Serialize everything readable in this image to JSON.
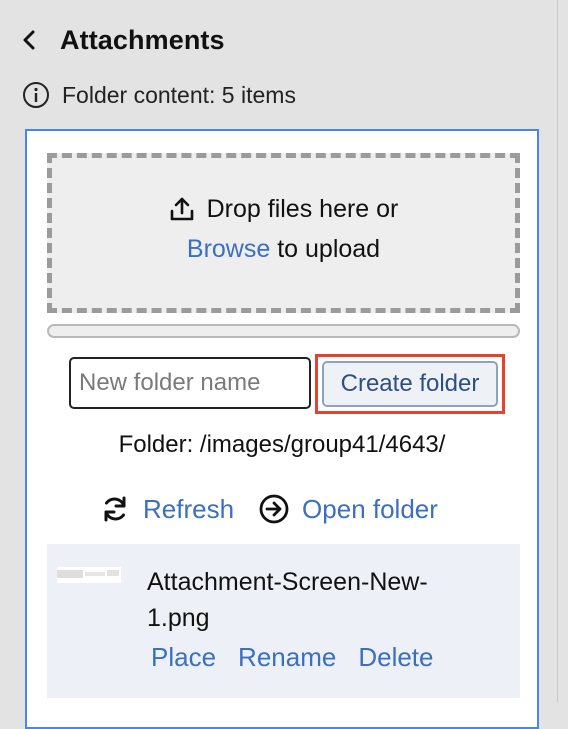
{
  "header": {
    "title": "Attachments",
    "back_icon": "chevron-left-icon"
  },
  "info": {
    "icon": "info-circle-icon",
    "text": "Folder content: 5 items"
  },
  "upload": {
    "icon": "upload-icon",
    "drop_text": "Drop files here or",
    "browse_label": "Browse",
    "upload_suffix": "to upload",
    "progress": 0
  },
  "new_folder": {
    "placeholder": "New folder name",
    "value": "",
    "create_label": "Create folder"
  },
  "folder": {
    "path_text": "Folder: /images/group41/4643/"
  },
  "actions": {
    "refresh_label": "Refresh",
    "refresh_icon": "refresh-icon",
    "open_label": "Open folder",
    "open_icon": "arrow-circle-right-icon"
  },
  "files": [
    {
      "name_line1": "Attachment-Screen-New-",
      "name_line2": "1.png",
      "place_label": "Place",
      "rename_label": "Rename",
      "delete_label": "Delete"
    }
  ],
  "colors": {
    "accent": "#4a86e8",
    "link": "#3b6fbf",
    "highlight": "#e5432d"
  }
}
